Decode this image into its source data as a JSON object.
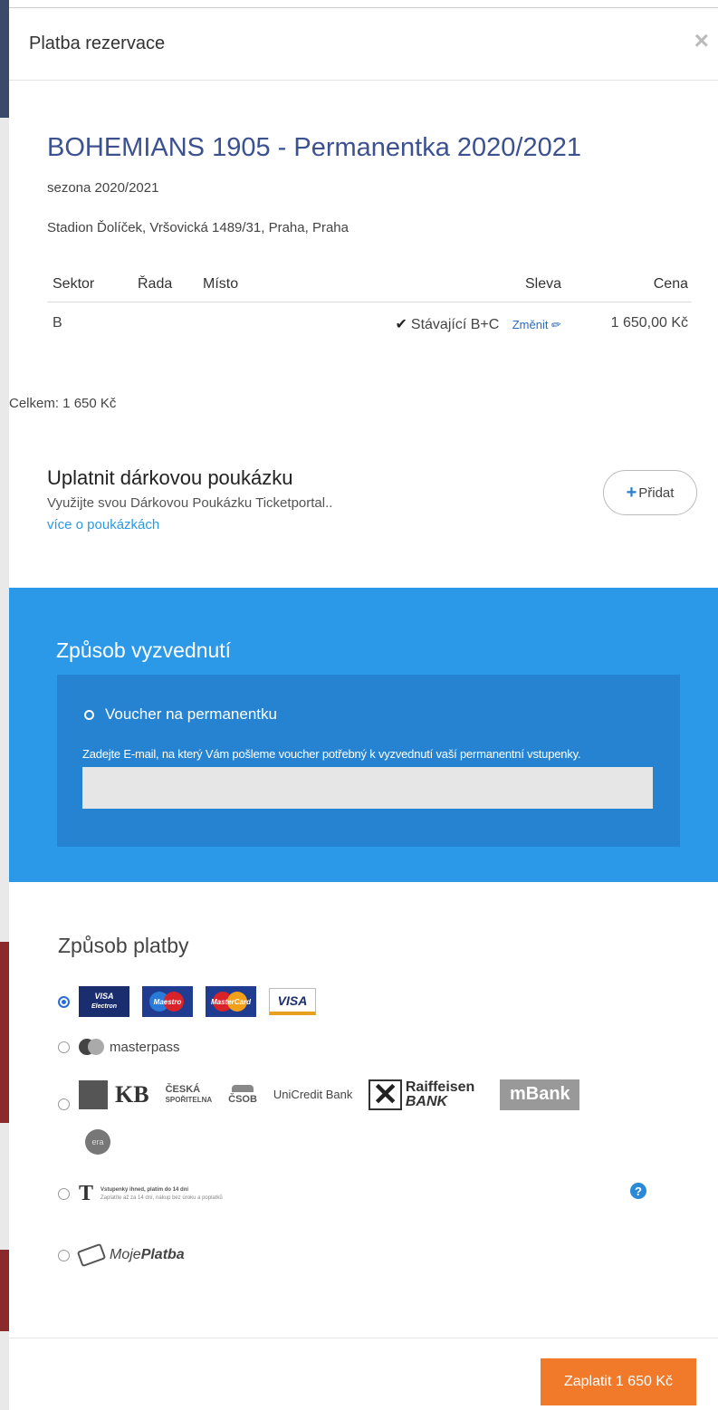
{
  "modal": {
    "title": "Platba rezervace",
    "close_symbol": "×"
  },
  "event": {
    "title": "BOHEMIANS 1905 - Permanentka 2020/2021",
    "season": "sezona 2020/2021",
    "venue": "Stadion Ďolíček, Vršovická 1489/31, Praha, Praha"
  },
  "table": {
    "headers": {
      "sektor": "Sektor",
      "rada": "Řada",
      "misto": "Místo",
      "sleva": "Sleva",
      "cena": "Cena"
    },
    "rows": [
      {
        "sektor": "B",
        "rada": "",
        "misto": "",
        "sleva": "Stávající B+C",
        "change_label": "Změnit",
        "cena": "1 650,00 Kč"
      }
    ]
  },
  "total": "Celkem: 1 650 Kč",
  "voucher": {
    "title": "Uplatnit dárkovou poukázku",
    "description": "Využijte svou Dárkovou Poukázku Ticketportal..",
    "link": "více o poukázkách",
    "add_label": "Přidat"
  },
  "pickup": {
    "title": "Způsob vyzvednutí",
    "option": "Voucher na permanentku",
    "hint": "Zadejte E-mail, na který Vám pošleme voucher potřebný k vyzvednutí vaší permanentní vstupenky.",
    "email_value": ""
  },
  "payment": {
    "title": "Způsob platby",
    "cards": {
      "visa_electron_top": "VISA",
      "visa_electron_bottom": "Electron",
      "maestro": "Maestro",
      "mastercard": "MasterCard",
      "visa": "VISA"
    },
    "masterpass": "masterpass",
    "banks": {
      "kb": "KB",
      "ceska_line1": "ČESKÁ",
      "ceska_line2": "SPOŘITELNA",
      "csob": "ČSOB",
      "unicredit": "UniCredit Bank",
      "raif_line1": "Raiffeisen",
      "raif_line2": "BANK",
      "mbank": "mBank",
      "era": "era"
    },
    "installments": {
      "logo": "T",
      "line1": "Vstupenky ihned, platím do 14 dní",
      "line2": "Zaplatíte až za 14 dní, nákup bez úroku a poplatků"
    },
    "mojeplatba_a": "Moje",
    "mojeplatba_b": "Platba",
    "help_symbol": "?",
    "selected_index": 0
  },
  "footer": {
    "pay_label": "Zaplatit 1 650 Kč"
  },
  "colors": {
    "accent_blue": "#2b99e8",
    "pay_orange": "#f0792a",
    "title_blue": "#3b5190"
  }
}
